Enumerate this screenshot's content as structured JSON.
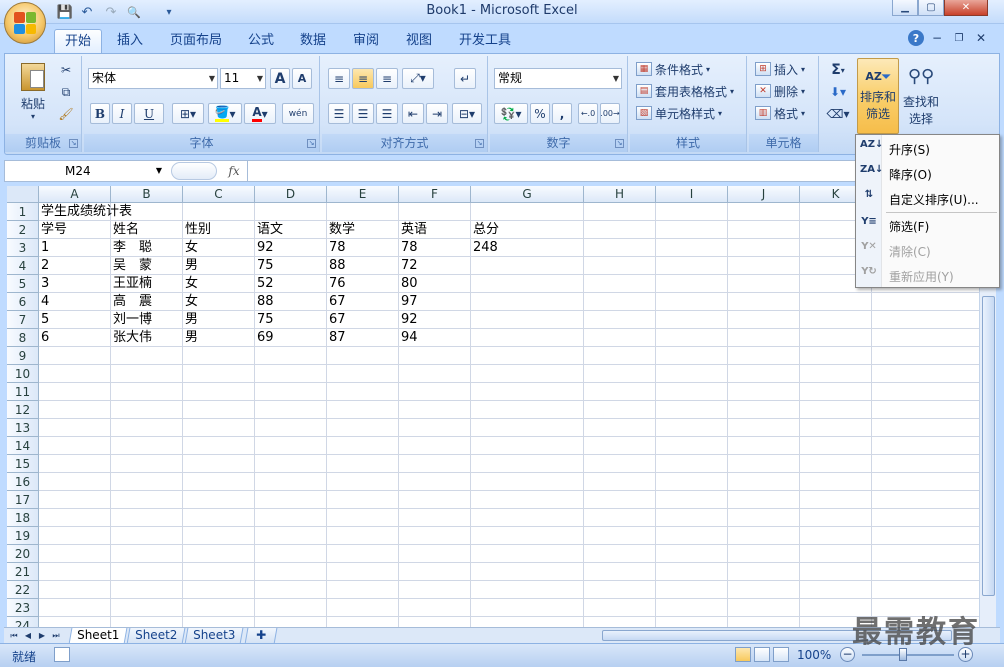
{
  "window": {
    "title": "Book1 - Microsoft Excel",
    "min_label": "▁",
    "max_label": "▢",
    "close_label": "✕"
  },
  "qat": {
    "save_icon": "💾",
    "undo_icon": "↶",
    "redo_icon": "↷",
    "preview_icon": "🔍",
    "customize_icon": "▾"
  },
  "tabs": [
    "开始",
    "插入",
    "页面布局",
    "公式",
    "数据",
    "审阅",
    "视图",
    "开发工具"
  ],
  "ribbon": {
    "clipboard": {
      "label": "剪贴板",
      "paste": "粘贴"
    },
    "font": {
      "label": "字体",
      "name": "宋体",
      "size": "11",
      "bold": "B",
      "italic": "I",
      "underline": "U",
      "grow": "A",
      "shrink": "A",
      "font_color": "A",
      "phonetic": "wén"
    },
    "alignment": {
      "label": "对齐方式"
    },
    "number": {
      "label": "数字",
      "format": "常规",
      "percent": "%",
      "comma": ","
    },
    "styles": {
      "label": "样式",
      "conditional": "条件格式",
      "table": "套用表格格式",
      "cell": "单元格样式"
    },
    "cells": {
      "label": "单元格",
      "insert": "插入",
      "delete": "删除",
      "format": "格式"
    },
    "editing": {
      "sum": "Σ",
      "sort_filter_1": "排序和",
      "sort_filter_2": "筛选",
      "find_1": "查找和",
      "find_2": "选择"
    }
  },
  "formula_bar": {
    "name_box": "M24",
    "fx": "fx",
    "formula": ""
  },
  "columns": [
    "A",
    "B",
    "C",
    "D",
    "E",
    "F",
    "G",
    "H",
    "I",
    "J",
    "K"
  ],
  "rows": [
    "1",
    "2",
    "3",
    "4",
    "5",
    "6",
    "7",
    "8",
    "9",
    "10",
    "11",
    "12",
    "13",
    "14",
    "15",
    "16",
    "17",
    "18",
    "19",
    "20",
    "21",
    "22",
    "23",
    "24"
  ],
  "cells": {
    "title": "学生成绩统计表",
    "headers": [
      "学号",
      "姓名",
      "性别",
      "语文",
      "数学",
      "英语",
      "总分"
    ],
    "data": [
      [
        "1",
        "李　聪",
        "女",
        "92",
        "78",
        "78",
        "248"
      ],
      [
        "2",
        "吴　蒙",
        "男",
        "75",
        "88",
        "72",
        ""
      ],
      [
        "3",
        "王亚楠",
        "女",
        "52",
        "76",
        "80",
        ""
      ],
      [
        "4",
        "高　震",
        "女",
        "88",
        "67",
        "97",
        ""
      ],
      [
        "5",
        "刘一博",
        "男",
        "75",
        "67",
        "92",
        ""
      ],
      [
        "6",
        "张大伟",
        "男",
        "69",
        "87",
        "94",
        ""
      ]
    ]
  },
  "sheets": [
    "Sheet1",
    "Sheet2",
    "Sheet3"
  ],
  "status": {
    "ready": "就绪",
    "zoom": "100%",
    "zoom_out": "−",
    "zoom_in": "+"
  },
  "menu": {
    "items": [
      {
        "label": "升序(S)",
        "icon": "AZ↓",
        "enabled": true
      },
      {
        "label": "降序(O)",
        "icon": "ZA↓",
        "enabled": true
      },
      {
        "label": "自定义排序(U)...",
        "icon": "⇅",
        "enabled": true
      },
      {
        "label": "筛选(F)",
        "icon": "Y≡",
        "enabled": true
      },
      {
        "label": "清除(C)",
        "icon": "Y✕",
        "enabled": false
      },
      {
        "label": "重新应用(Y)",
        "icon": "Y↻",
        "enabled": false
      }
    ]
  },
  "watermark": "最需教育",
  "colors": {
    "ribbon_bg": "#d4e4f9",
    "accent": "#15428b",
    "sort_button_hot": "#fcd88a"
  }
}
